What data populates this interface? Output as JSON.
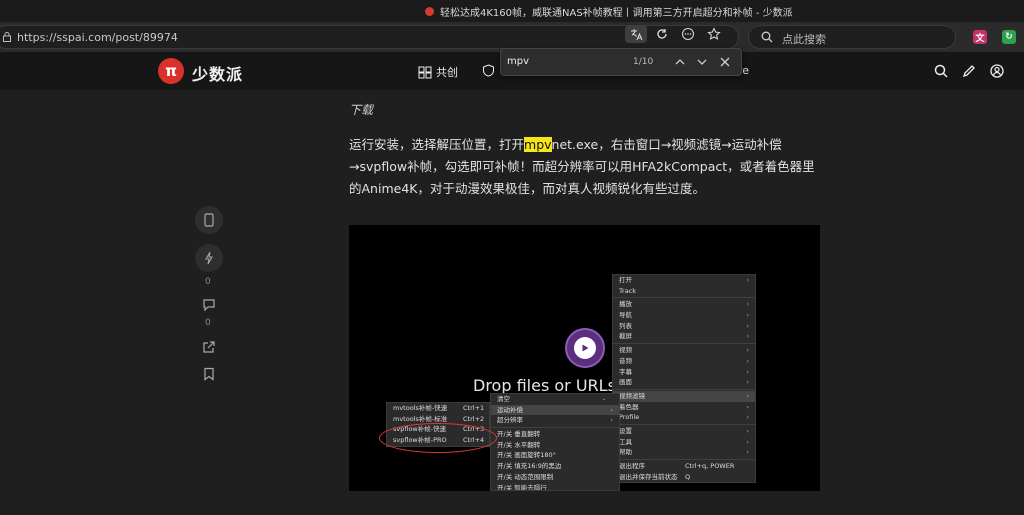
{
  "browser": {
    "tab_title": "轻松达成4K160帧，威联通NAS补帧教程丨调用第三方开启超分和补帧 - 少数派",
    "url": "https://sspai.com/post/89974",
    "search_placeholder": "点此搜索"
  },
  "find_bar": {
    "query": "mpv",
    "count": "1/10"
  },
  "site": {
    "logo_glyph": "π",
    "logo_text": "少数派",
    "nav": [
      {
        "label": "共创"
      },
      {
        "label": ""
      },
      {
        "label": "re"
      }
    ]
  },
  "article_tools": {
    "like_count": "0",
    "comment_count": "0"
  },
  "article": {
    "subtitle": "下载",
    "para_before": "运行安装，选择解压位置，打开",
    "para_highlight": "mpv",
    "para_after": "net.exe，右击窗口→视频滤镜→运动补偿→svpflow补帧，勾选即可补帧！而超分辨率可以用HFA2kCompact，或者着色器里的Anime4K，对于动漫效果极佳，而对真人视频锐化有些过度。"
  },
  "screenshot": {
    "drop_text": "Drop files or URLs t",
    "main_menu": [
      {
        "label": "打开",
        "arrow": true
      },
      {
        "label": "Track",
        "arrow": false
      },
      {
        "sep": true
      },
      {
        "label": "播放",
        "arrow": true
      },
      {
        "label": "导航",
        "arrow": true
      },
      {
        "label": "列表",
        "arrow": true
      },
      {
        "label": "截屏",
        "arrow": true
      },
      {
        "sep": true
      },
      {
        "label": "视频",
        "arrow": true
      },
      {
        "label": "音频",
        "arrow": true
      },
      {
        "label": "字幕",
        "arrow": true
      },
      {
        "label": "画面",
        "arrow": true
      },
      {
        "sep": true
      },
      {
        "label": "视频滤镜",
        "arrow": true,
        "sel": true
      },
      {
        "label": "着色器",
        "arrow": true
      },
      {
        "label": "Profile",
        "arrow": true
      },
      {
        "sep": true
      },
      {
        "label": "设置",
        "arrow": true
      },
      {
        "label": "工具",
        "arrow": true
      },
      {
        "label": "帮助",
        "arrow": true
      },
      {
        "sep": true
      },
      {
        "label": "退出程序",
        "shortcut": "Ctrl+q, POWER"
      },
      {
        "label": "退出并保存当前状态",
        "shortcut": "Q"
      }
    ],
    "filter_menu": [
      {
        "label": "清空",
        "shortcut": "-"
      },
      {
        "label": "运动补偿",
        "arrow": true,
        "sel": true
      },
      {
        "label": "超分辨率",
        "arrow": true
      },
      {
        "sep": true
      },
      {
        "label": "开/关 垂直翻转"
      },
      {
        "label": "开/关 水平翻转"
      },
      {
        "label": "开/关 画面旋转180°"
      },
      {
        "label": "开/关 填充16:9的黑边"
      },
      {
        "label": "开/关 动态范围限制"
      },
      {
        "label": "开/关 智能去隔行"
      }
    ],
    "motion_menu": [
      {
        "label": "mvtools补帧-快速",
        "shortcut": "Ctrl+1"
      },
      {
        "label": "mvtools补帧-标准",
        "shortcut": "Ctrl+2"
      },
      {
        "label": "svpflow补帧-快速",
        "shortcut": "Ctrl+3"
      },
      {
        "label": "svpflow补帧-PRO",
        "shortcut": "Ctrl+4"
      }
    ]
  },
  "colors": {
    "brand": "#d9322b",
    "highlight": "#f5e51a",
    "annotation": "#d93a33"
  }
}
